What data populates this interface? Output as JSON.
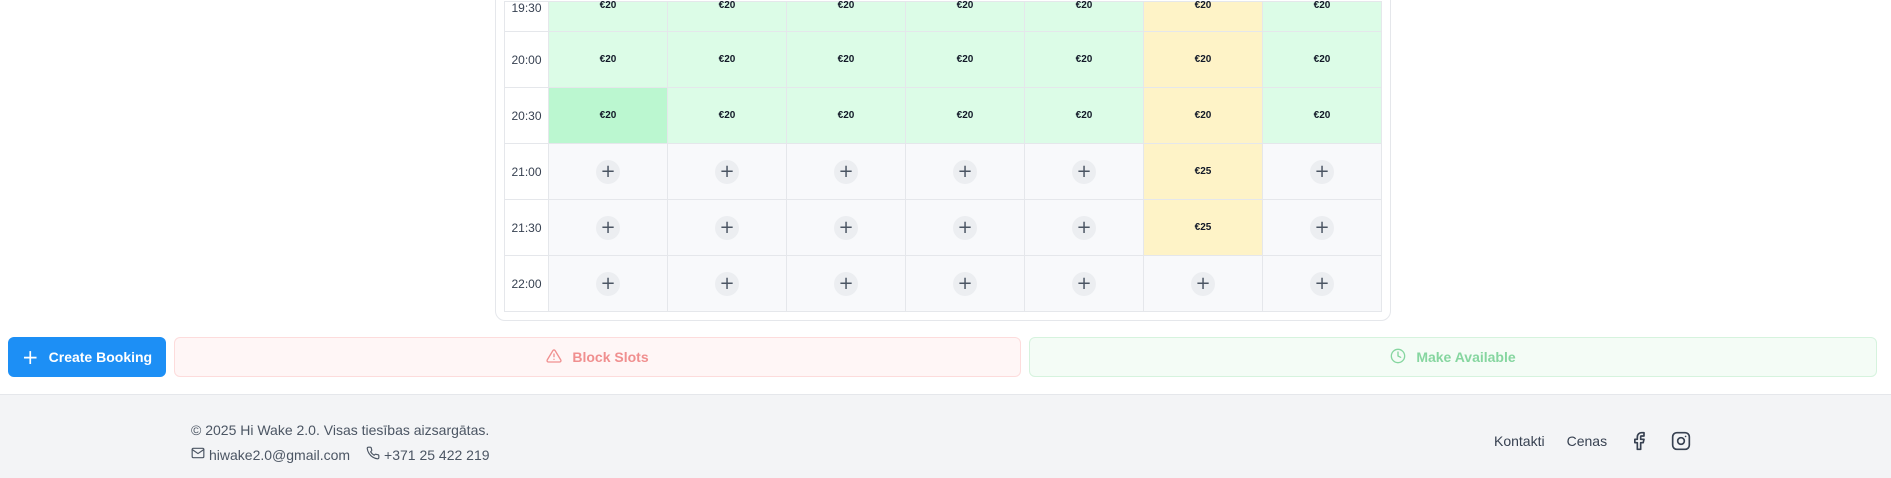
{
  "schedule": {
    "rows": [
      {
        "time": "19:30",
        "cells": [
          {
            "kind": "price",
            "label": "€20"
          },
          {
            "kind": "price",
            "label": "€20"
          },
          {
            "kind": "price",
            "label": "€20"
          },
          {
            "kind": "price",
            "label": "€20"
          },
          {
            "kind": "price",
            "label": "€20"
          },
          {
            "kind": "special",
            "label": "€20"
          },
          {
            "kind": "price",
            "label": "€20"
          }
        ]
      },
      {
        "time": "20:00",
        "cells": [
          {
            "kind": "price",
            "label": "€20"
          },
          {
            "kind": "price",
            "label": "€20"
          },
          {
            "kind": "price",
            "label": "€20"
          },
          {
            "kind": "price",
            "label": "€20"
          },
          {
            "kind": "price",
            "label": "€20"
          },
          {
            "kind": "special",
            "label": "€20"
          },
          {
            "kind": "price",
            "label": "€20"
          }
        ]
      },
      {
        "time": "20:30",
        "cells": [
          {
            "kind": "selected",
            "label": "€20"
          },
          {
            "kind": "price",
            "label": "€20"
          },
          {
            "kind": "price",
            "label": "€20"
          },
          {
            "kind": "price",
            "label": "€20"
          },
          {
            "kind": "price",
            "label": "€20"
          },
          {
            "kind": "special",
            "label": "€20"
          },
          {
            "kind": "price",
            "label": "€20"
          }
        ]
      },
      {
        "time": "21:00",
        "cells": [
          {
            "kind": "empty"
          },
          {
            "kind": "empty"
          },
          {
            "kind": "empty"
          },
          {
            "kind": "empty"
          },
          {
            "kind": "empty"
          },
          {
            "kind": "special",
            "label": "€25"
          },
          {
            "kind": "empty"
          }
        ]
      },
      {
        "time": "21:30",
        "cells": [
          {
            "kind": "empty"
          },
          {
            "kind": "empty"
          },
          {
            "kind": "empty"
          },
          {
            "kind": "empty"
          },
          {
            "kind": "empty"
          },
          {
            "kind": "special",
            "label": "€25"
          },
          {
            "kind": "empty"
          }
        ]
      },
      {
        "time": "22:00",
        "cells": [
          {
            "kind": "empty"
          },
          {
            "kind": "empty"
          },
          {
            "kind": "empty"
          },
          {
            "kind": "empty"
          },
          {
            "kind": "empty"
          },
          {
            "kind": "empty"
          },
          {
            "kind": "empty"
          }
        ]
      }
    ],
    "colors": {
      "available": "#dcfce7",
      "selected": "#bbf7d0",
      "special": "#fef3c7",
      "empty": "#f8f9fb"
    }
  },
  "actions": {
    "create_booking": {
      "label": "Create Booking",
      "icon": "plus-icon",
      "color": "#1d8ff5"
    },
    "block_slots": {
      "label": "Block Slots",
      "icon": "warning-triangle-icon",
      "color": "#f08f8f"
    },
    "make_available": {
      "label": "Make Available",
      "icon": "clock-icon",
      "color": "#86d6a0"
    }
  },
  "footer": {
    "copyright": "© 2025 Hi Wake 2.0. Visas tiesības aizsargātas.",
    "email": "hiwake2.0@gmail.com",
    "phone": "+371 25 422 219",
    "links": [
      {
        "label": "Kontakti"
      },
      {
        "label": "Cenas"
      }
    ],
    "social": [
      {
        "icon": "facebook-icon"
      },
      {
        "icon": "instagram-icon"
      }
    ]
  }
}
